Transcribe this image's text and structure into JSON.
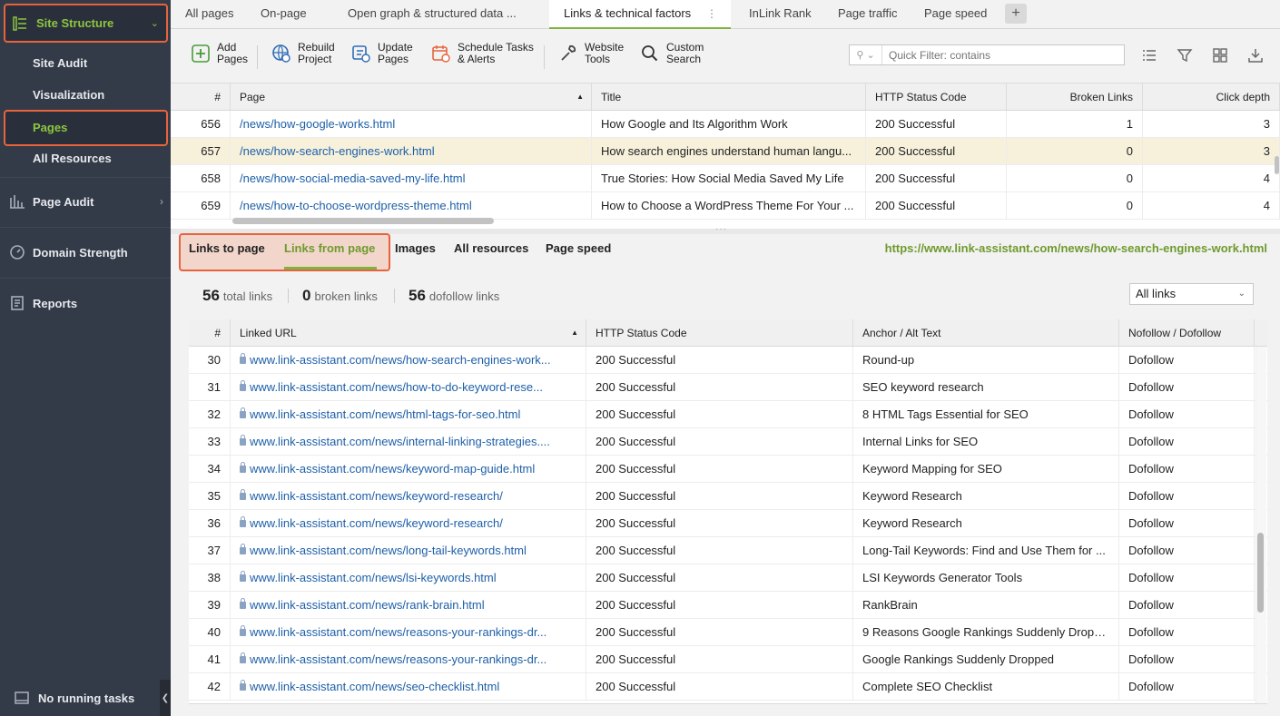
{
  "sidebar": {
    "site_structure": "Site Structure",
    "sub_items": [
      "Site Audit",
      "Visualization",
      "Pages",
      "All Resources"
    ],
    "sections": [
      "Page Audit",
      "Domain Strength",
      "Reports"
    ],
    "footer": "No running tasks"
  },
  "tabs": [
    "All pages",
    "On-page",
    "Open graph & structured data ...",
    "Links & technical factors",
    "InLink Rank",
    "Page traffic",
    "Page speed"
  ],
  "tabs_add": "+",
  "toolbar": {
    "buttons": [
      {
        "line1": "Add",
        "line2": "Pages"
      },
      {
        "line1": "Rebuild",
        "line2": "Project"
      },
      {
        "line1": "Update",
        "line2": "Pages"
      },
      {
        "line1": "Schedule Tasks",
        "line2": "& Alerts"
      },
      {
        "line1": "Website",
        "line2": "Tools"
      },
      {
        "line1": "Custom",
        "line2": "Search"
      }
    ],
    "filter_placeholder": "Quick Filter: contains"
  },
  "top_table": {
    "headers": [
      "#",
      "Page",
      "Title",
      "HTTP Status Code",
      "Broken Links",
      "Click depth"
    ],
    "rows": [
      [
        "656",
        "/news/how-google-works.html",
        "How Google and Its Algorithm Work",
        "200 Successful",
        "1",
        "3"
      ],
      [
        "657",
        "/news/how-search-engines-work.html",
        "How search engines understand human langu...",
        "200 Successful",
        "0",
        "3"
      ],
      [
        "658",
        "/news/how-social-media-saved-my-life.html",
        "True Stories: How Social Media Saved My Life",
        "200 Successful",
        "0",
        "4"
      ],
      [
        "659",
        "/news/how-to-choose-wordpress-theme.html",
        "How to Choose a WordPress Theme For Your ...",
        "200 Successful",
        "0",
        "4"
      ]
    ]
  },
  "subtabs": [
    "Links to page",
    "Links from page",
    "Images",
    "All resources",
    "Page speed"
  ],
  "page_url": "https://www.link-assistant.com/news/how-search-engines-work.html",
  "summary": {
    "total": "56",
    "total_label": "total links",
    "broken": "0",
    "broken_label": "broken links",
    "dofollow": "56",
    "dofollow_label": "dofollow links",
    "select_value": "All links"
  },
  "bottom_table": {
    "headers": [
      "#",
      "Linked URL",
      "HTTP Status Code",
      "Anchor / Alt Text",
      "Nofollow / Dofollow"
    ],
    "rows": [
      [
        "30",
        "www.link-assistant.com/news/how-search-engines-work...",
        "200 Successful",
        "Round-up",
        "Dofollow"
      ],
      [
        "31",
        "www.link-assistant.com/news/how-to-do-keyword-rese...",
        "200 Successful",
        "SEO keyword research",
        "Dofollow"
      ],
      [
        "32",
        "www.link-assistant.com/news/html-tags-for-seo.html",
        "200 Successful",
        "8 HTML Tags Essential for SEO",
        "Dofollow"
      ],
      [
        "33",
        "www.link-assistant.com/news/internal-linking-strategies....",
        "200 Successful",
        "Internal Links for SEO",
        "Dofollow"
      ],
      [
        "34",
        "www.link-assistant.com/news/keyword-map-guide.html",
        "200 Successful",
        "Keyword Mapping for SEO",
        "Dofollow"
      ],
      [
        "35",
        "www.link-assistant.com/news/keyword-research/",
        "200 Successful",
        "Keyword Research",
        "Dofollow"
      ],
      [
        "36",
        "www.link-assistant.com/news/keyword-research/",
        "200 Successful",
        "Keyword Research",
        "Dofollow"
      ],
      [
        "37",
        "www.link-assistant.com/news/long-tail-keywords.html",
        "200 Successful",
        "Long-Tail Keywords: Find and Use Them for ...",
        "Dofollow"
      ],
      [
        "38",
        "www.link-assistant.com/news/lsi-keywords.html",
        "200 Successful",
        "LSI Keywords Generator Tools",
        "Dofollow"
      ],
      [
        "39",
        "www.link-assistant.com/news/rank-brain.html",
        "200 Successful",
        "RankBrain",
        "Dofollow"
      ],
      [
        "40",
        "www.link-assistant.com/news/reasons-your-rankings-dr...",
        "200 Successful",
        "9 Reasons Google Rankings Suddenly Dropp...",
        "Dofollow"
      ],
      [
        "41",
        "www.link-assistant.com/news/reasons-your-rankings-dr...",
        "200 Successful",
        "Google Rankings Suddenly Dropped",
        "Dofollow"
      ],
      [
        "42",
        "www.link-assistant.com/news/seo-checklist.html",
        "200 Successful",
        "Complete SEO Checklist",
        "Dofollow"
      ]
    ]
  },
  "colors": {
    "accent": "#8cc63f",
    "highlight": "#e8633c",
    "link": "#1d5fa8",
    "sidebar": "#333b48"
  }
}
